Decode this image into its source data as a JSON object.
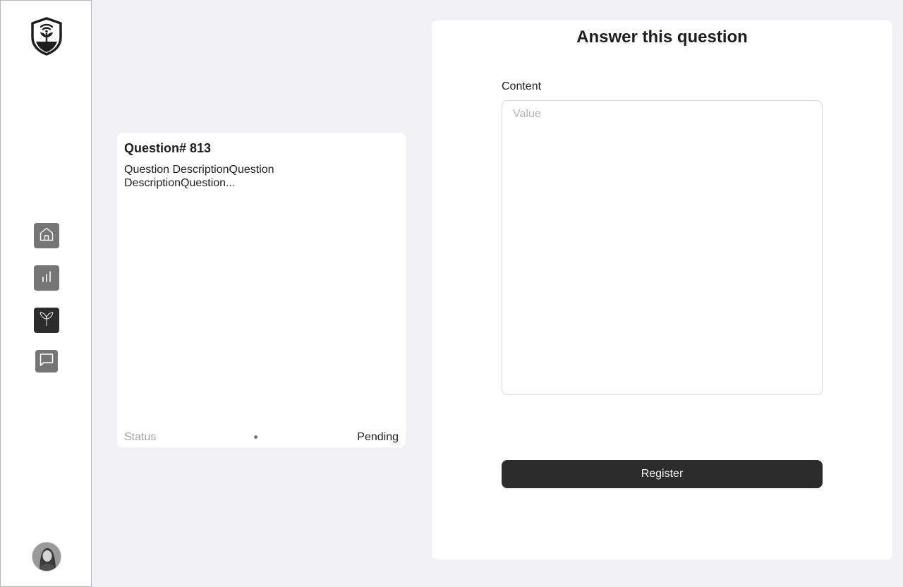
{
  "sidebar": {
    "logo": "plant-shield-logo",
    "nav": [
      {
        "icon": "home-icon",
        "active": false
      },
      {
        "icon": "bar-chart-icon",
        "active": false
      },
      {
        "icon": "leaf-icon",
        "active": true
      },
      {
        "icon": "chat-icon",
        "active": false
      }
    ],
    "avatar": "user-avatar"
  },
  "question": {
    "title": "Question# 813",
    "description": "Question DescriptionQuestion DescriptionQuestion...",
    "status_label": "Status",
    "status_value": "Pending"
  },
  "answer": {
    "title": "Answer this question",
    "content_label": "Content",
    "content_placeholder": "Value",
    "content_value": "",
    "submit_label": "Register"
  },
  "colors": {
    "background": "#f1f1f6",
    "card": "#ffffff",
    "primary_button": "#2c2c2c",
    "nav_icon_bg": "#757575",
    "nav_icon_active_bg": "#2c2c2c"
  }
}
